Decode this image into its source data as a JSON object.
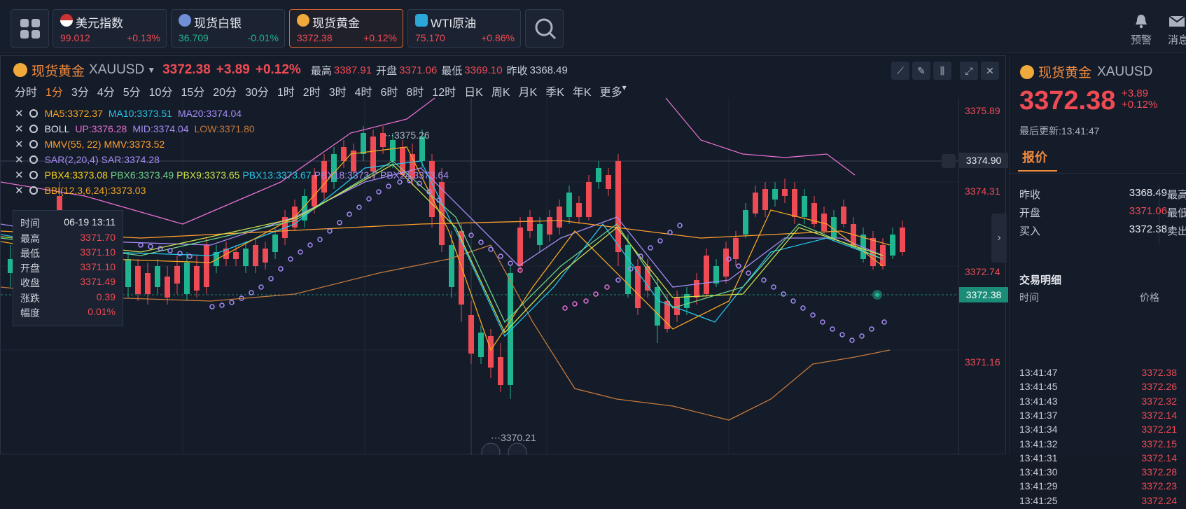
{
  "tickers": [
    {
      "name": "美元指数",
      "price": "99.012",
      "change": "+0.13%",
      "dir": "up",
      "icon": "us-flag-icon",
      "active": false
    },
    {
      "name": "现货白银",
      "price": "36.709",
      "change": "-0.01%",
      "dir": "down",
      "icon": "silver-icon",
      "active": false
    },
    {
      "name": "现货黄金",
      "price": "3372.38",
      "change": "+0.12%",
      "dir": "up",
      "icon": "gold-icon",
      "active": true
    },
    {
      "name": "WTI原油",
      "price": "75.170",
      "change": "+0.86%",
      "dir": "up",
      "icon": "oil-icon",
      "active": false
    }
  ],
  "topright": {
    "alert_label": "预警",
    "msg_label": "消息"
  },
  "header": {
    "name": "现货黄金",
    "symbol": "XAUUSD",
    "price": "3372.38",
    "change": "+3.89",
    "change_pct": "+0.12%",
    "high_label": "最高",
    "high": "3387.91",
    "open_label": "开盘",
    "open": "3371.06",
    "low_label": "最低",
    "low": "3369.10",
    "prev_label": "昨收",
    "prev": "3368.49"
  },
  "intervals": [
    "分时",
    "1分",
    "3分",
    "4分",
    "5分",
    "10分",
    "15分",
    "20分",
    "30分",
    "1时",
    "2时",
    "3时",
    "4时",
    "6时",
    "8时",
    "12时",
    "日K",
    "周K",
    "月K",
    "季K",
    "年K",
    "更多"
  ],
  "active_interval": "1分",
  "indicators": {
    "ma": {
      "ma5": "MA5:3372.37",
      "ma10": "MA10:3373.51",
      "ma20": "MA20:3374.04"
    },
    "boll": {
      "name": "BOLL",
      "up": "UP:3376.28",
      "mid": "MID:3374.04",
      "low": "LOW:3371.80"
    },
    "mmv": {
      "name": "MMV(55, 22)",
      "val": "MMV:3373.52"
    },
    "sar": {
      "name": "SAR(2,20,4)",
      "val": "SAR:3374.28"
    },
    "pbx": {
      "p4": "PBX4:3373.08",
      "p6": "PBX6:3373.49",
      "p9": "PBX9:3373.65",
      "p13": "PBX13:3373.67",
      "p18": "PBX18:3373.7",
      "p24": "PBX24:3373.64"
    },
    "bbi": {
      "val": "BBI(12,3,6,24):3373.03"
    }
  },
  "tooltip": {
    "time_label": "时间",
    "time": "06-19 13:11",
    "high_label": "最高",
    "high": "3371.70",
    "low_label": "最低",
    "low": "3371.10",
    "open_label": "开盘",
    "open": "3371.10",
    "close_label": "收盘",
    "close": "3371.49",
    "change_label": "涨跌",
    "change": "0.39",
    "range_label": "幅度",
    "range": "0.01%"
  },
  "price_axis": [
    "3375.89",
    "3374.31",
    "3372.74",
    "3371.16"
  ],
  "hover_price": "3374.90",
  "current_price": "3372.38",
  "chart_marks": {
    "max_label": "3375.26",
    "min_label": "3370.21"
  },
  "colors": {
    "up": "#ee4b54",
    "down": "#1fb590",
    "accent": "#f08a3c",
    "ma5": "#f5a623",
    "ma10": "#27c3e6",
    "ma20": "#a68cf5",
    "mmv": "#ff9f2e",
    "boll": "#e76fd0",
    "bbi": "#f5a623"
  },
  "side": {
    "name": "现货黄金",
    "symbol": "XAUUSD",
    "price": "3372.38",
    "change": "+3.89",
    "change_pct": "+0.12%",
    "updated": "最后更新:13:41:47",
    "tab": "报价",
    "quotes": [
      {
        "label": "昨收",
        "value": "3368.49",
        "color": "normal",
        "right": "最高"
      },
      {
        "label": "开盘",
        "value": "3371.06",
        "color": "red",
        "right": "最低"
      },
      {
        "label": "买入",
        "value": "3372.38",
        "color": "normal",
        "right": "卖出"
      }
    ],
    "trades_title": "交易明细",
    "col_time": "时间",
    "col_price": "价格",
    "trades": [
      {
        "time": "13:41:47",
        "price": "3372.38"
      },
      {
        "time": "13:41:45",
        "price": "3372.26"
      },
      {
        "time": "13:41:43",
        "price": "3372.32"
      },
      {
        "time": "13:41:37",
        "price": "3372.14"
      },
      {
        "time": "13:41:34",
        "price": "3372.21"
      },
      {
        "time": "13:41:32",
        "price": "3372.15"
      },
      {
        "time": "13:41:31",
        "price": "3372.14"
      },
      {
        "time": "13:41:30",
        "price": "3372.28"
      },
      {
        "time": "13:41:29",
        "price": "3372.23"
      },
      {
        "time": "13:41:25",
        "price": "3372.24"
      }
    ]
  }
}
